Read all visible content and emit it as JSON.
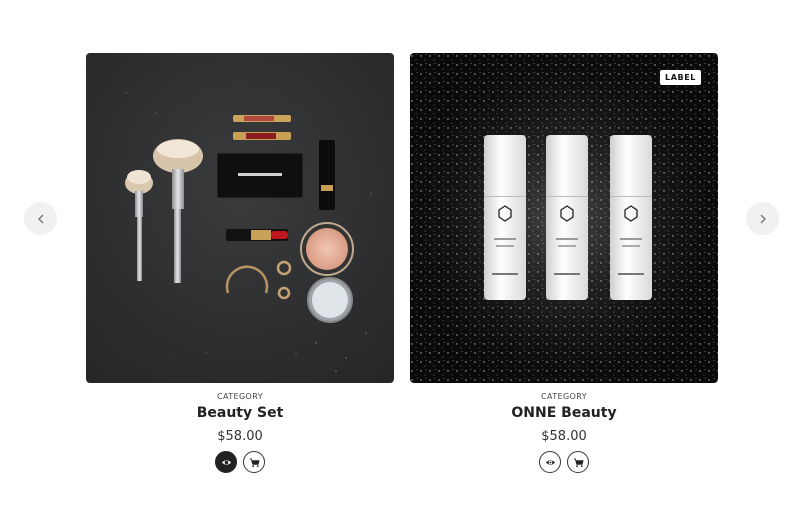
{
  "carousel": {
    "prev_icon": "chevron-left-icon",
    "next_icon": "chevron-right-icon"
  },
  "products": [
    {
      "category": "CATEGORY",
      "title": "Beauty Set",
      "price": "$58.00",
      "badge": "",
      "image": "makeup-flatlay",
      "quick_view_active": true
    },
    {
      "category": "CATEGORY",
      "title": "ONNE Beauty",
      "price": "$58.00",
      "badge": "LABEL",
      "image": "onne-bottles",
      "quick_view_active": false
    }
  ],
  "colors": {
    "nav_bg": "#f1f1f1",
    "active_btn": "#222222"
  }
}
